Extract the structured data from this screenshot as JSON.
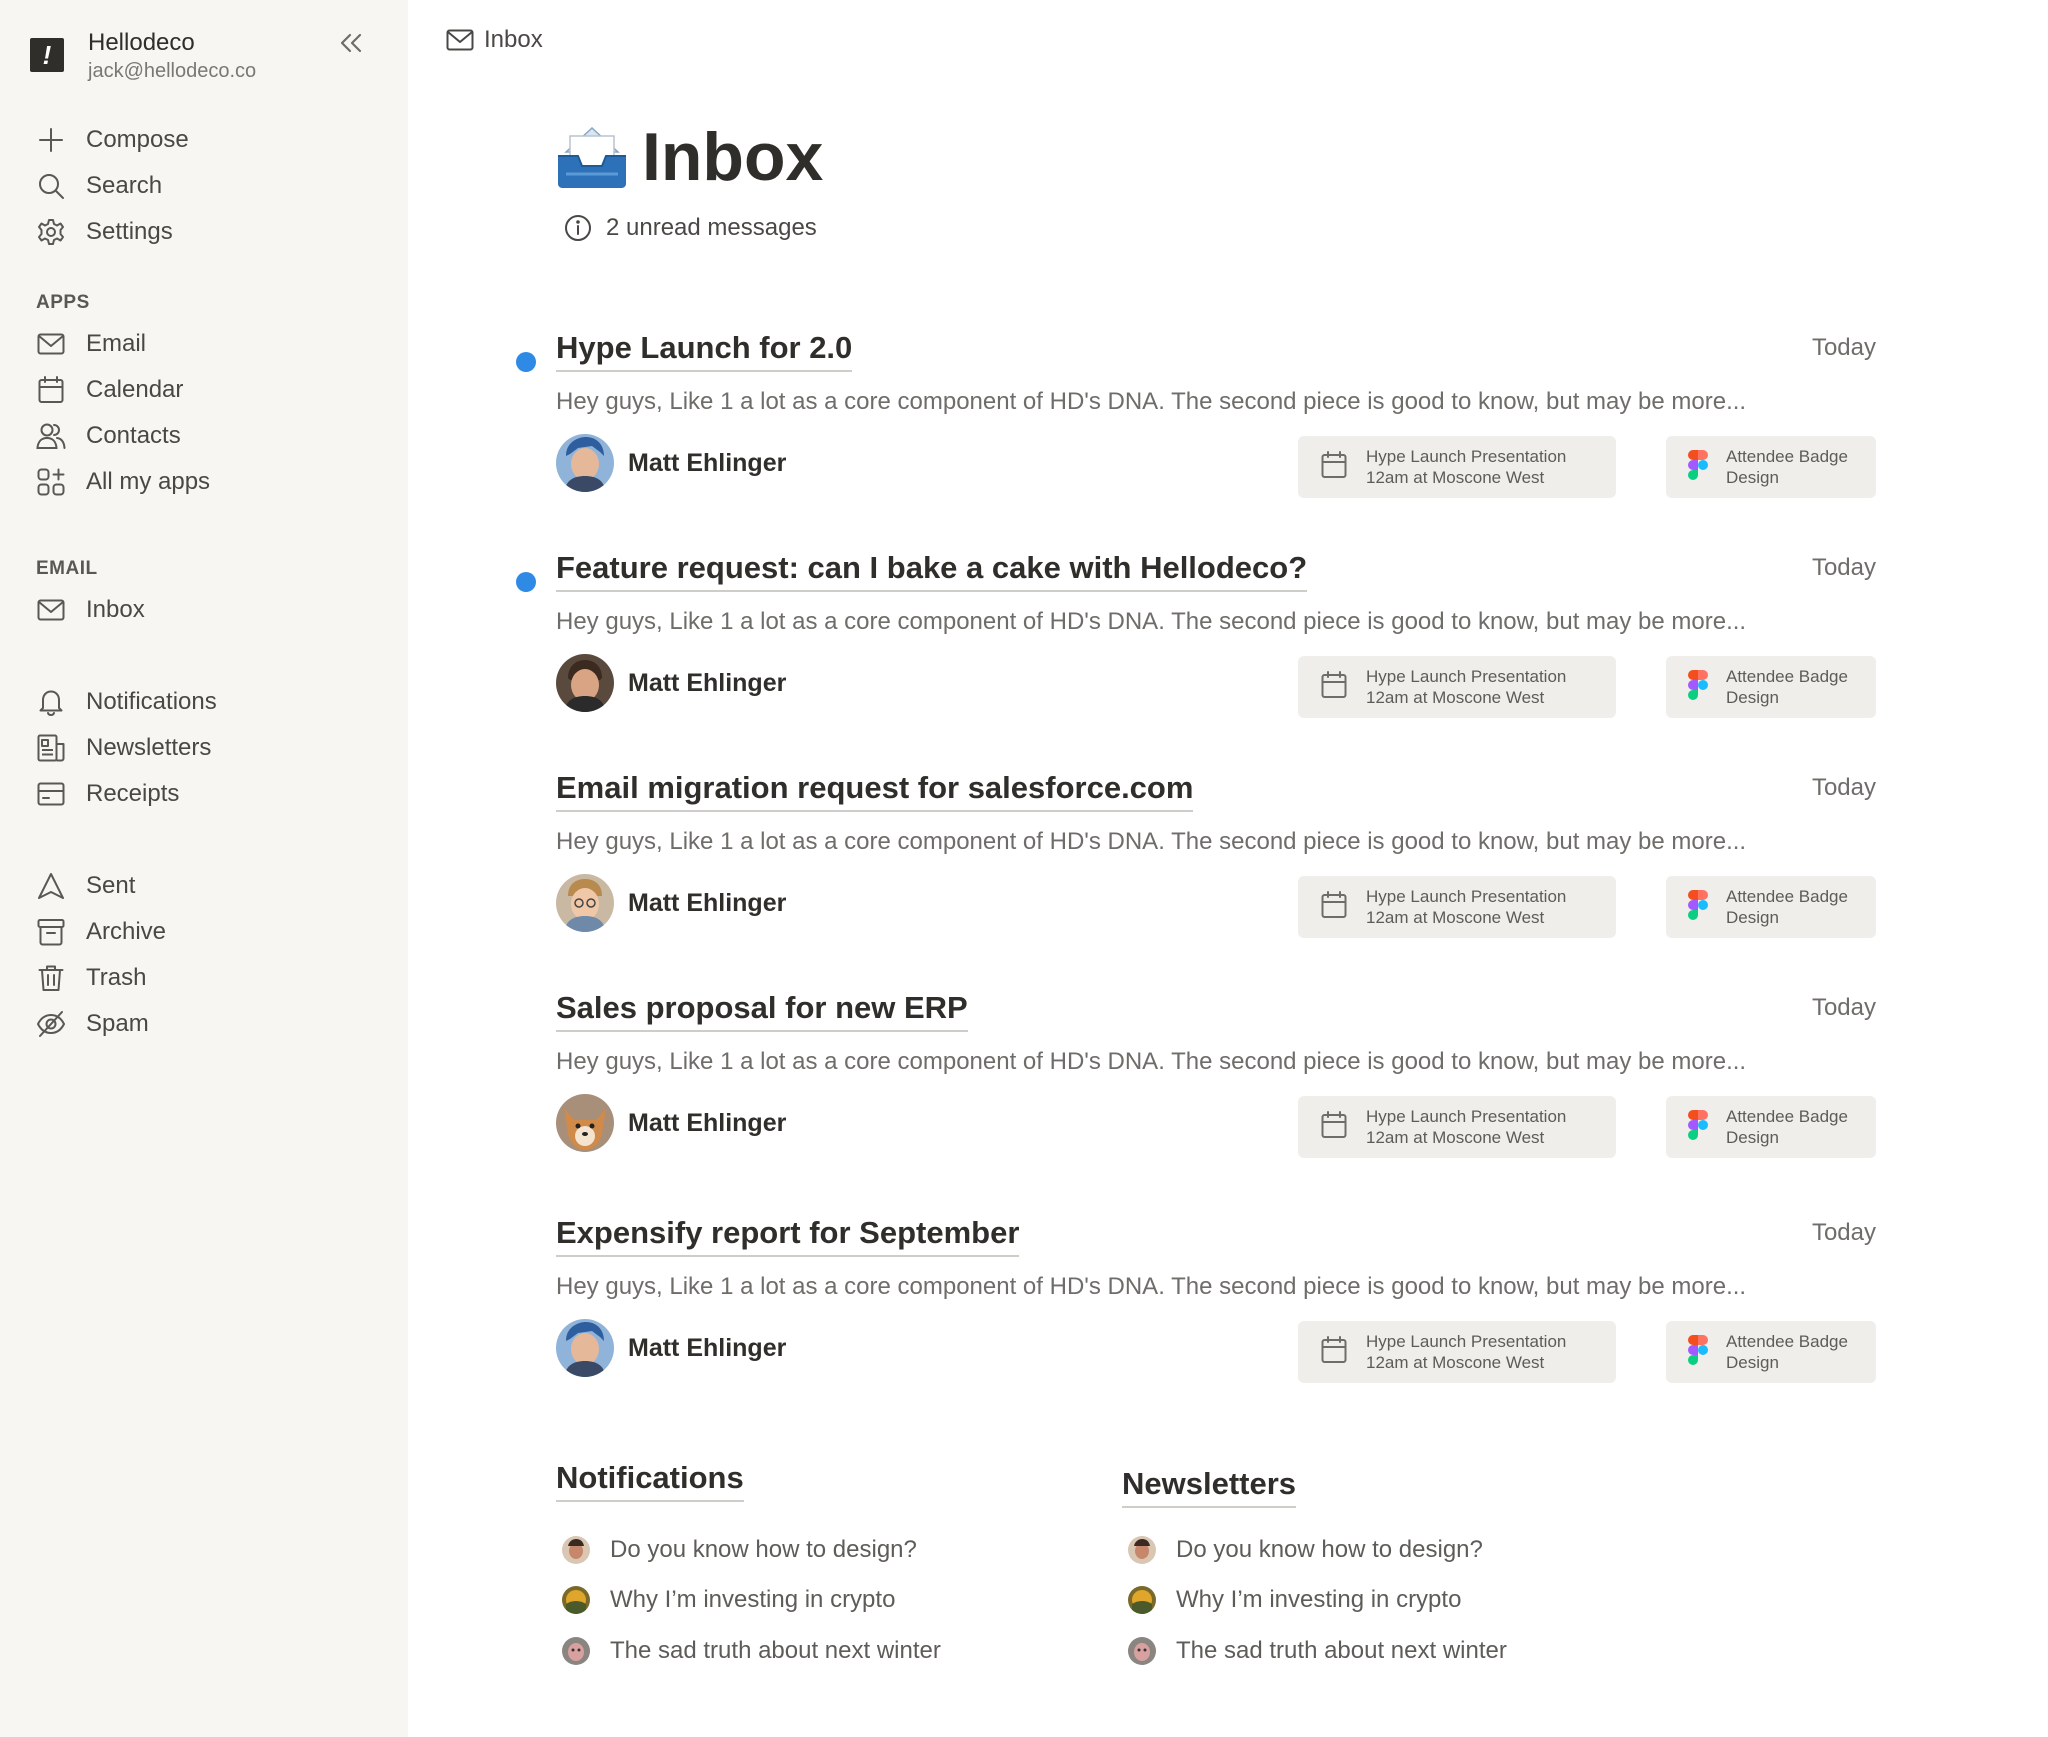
{
  "workspace": {
    "logo": "!",
    "name": "Hellodeco",
    "email": "jack@hellodeco.co"
  },
  "sidebar": {
    "top_items": [
      {
        "label": "Compose",
        "icon": "plus-icon"
      },
      {
        "label": "Search",
        "icon": "search-icon"
      },
      {
        "label": "Settings",
        "icon": "gear-icon"
      }
    ],
    "apps_label": "APPS",
    "apps": [
      {
        "label": "Email",
        "icon": "mail-icon"
      },
      {
        "label": "Calendar",
        "icon": "calendar-icon"
      },
      {
        "label": "Contacts",
        "icon": "contacts-icon"
      },
      {
        "label": "All my apps",
        "icon": "apps-grid-icon"
      }
    ],
    "email_label": "EMAIL",
    "email_items": [
      {
        "label": "Inbox",
        "icon": "mail-icon"
      }
    ],
    "category_items": [
      {
        "label": "Notifications",
        "icon": "bell-icon"
      },
      {
        "label": "Newsletters",
        "icon": "newspaper-icon"
      },
      {
        "label": "Receipts",
        "icon": "receipt-icon"
      }
    ],
    "folder_items": [
      {
        "label": "Sent",
        "icon": "send-icon"
      },
      {
        "label": "Archive",
        "icon": "archive-icon"
      },
      {
        "label": "Trash",
        "icon": "trash-icon"
      },
      {
        "label": "Spam",
        "icon": "spam-icon"
      }
    ]
  },
  "breadcrumb": {
    "label": "Inbox"
  },
  "page": {
    "title": "Inbox",
    "unread": "2 unread messages"
  },
  "messages": [
    {
      "subject": "Hype Launch for 2.0",
      "unread": true,
      "date": "Today",
      "preview": "Hey guys, Like 1 a lot as a core component of HD's DNA.  The second piece is good to know, but may be more...",
      "sender": "Matt Ehlinger",
      "event_line1": "Hype Launch Presentation",
      "event_line2": "12am at Moscone West",
      "file_line1": "Attendee Badge",
      "file_line2": "Design"
    },
    {
      "subject": "Feature request: can I bake a cake with Hellodeco?",
      "unread": true,
      "date": "Today",
      "preview": "Hey guys, Like 1 a lot as a core component of HD's DNA.  The second piece is good to know, but may be more...",
      "sender": "Matt Ehlinger",
      "event_line1": "Hype Launch Presentation",
      "event_line2": "12am at Moscone West",
      "file_line1": "Attendee Badge",
      "file_line2": "Design"
    },
    {
      "subject": "Email migration request for salesforce.com",
      "unread": false,
      "date": "Today",
      "preview": "Hey guys, Like 1 a lot as a core component of HD's DNA.  The second piece is good to know, but may be more...",
      "sender": "Matt Ehlinger",
      "event_line1": "Hype Launch Presentation",
      "event_line2": "12am at Moscone West",
      "file_line1": "Attendee Badge",
      "file_line2": "Design"
    },
    {
      "subject": "Sales proposal for new ERP",
      "unread": false,
      "date": "Today",
      "preview": "Hey guys, Like 1 a lot as a core component of HD's DNA.  The second piece is good to know, but may be more...",
      "sender": "Matt Ehlinger",
      "event_line1": "Hype Launch Presentation",
      "event_line2": "12am at Moscone West",
      "file_line1": "Attendee Badge",
      "file_line2": "Design"
    },
    {
      "subject": "Expensify report for September",
      "unread": false,
      "date": "Today",
      "preview": "Hey guys, Like 1 a lot as a core component of HD's DNA.  The second piece is good to know, but may be more...",
      "sender": "Matt Ehlinger",
      "event_line1": "Hype Launch Presentation",
      "event_line2": "12am at Moscone West",
      "file_line1": "Attendee Badge",
      "file_line2": "Design"
    }
  ],
  "notifications": {
    "title": "Notifications",
    "items": [
      {
        "label": "Do you know how to design?"
      },
      {
        "label": "Why I’m investing in crypto"
      },
      {
        "label": "The sad truth about next winter"
      }
    ]
  },
  "newsletters": {
    "title": "Newsletters",
    "items": [
      {
        "label": "Do you know how to design?"
      },
      {
        "label": "Why I’m investing in crypto"
      },
      {
        "label": "The sad truth about next winter"
      }
    ]
  },
  "colors": {
    "unread_dot": "#2f8ae6",
    "sidebar_bg": "#f7f6f3",
    "chip_bg": "#efeeeb",
    "text_primary": "#2f2e2b"
  }
}
